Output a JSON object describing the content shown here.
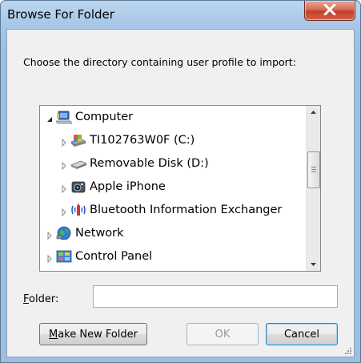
{
  "window": {
    "title": "Browse For Folder"
  },
  "instruction": "Choose the directory containing user profile to import:",
  "tree": {
    "items": [
      {
        "label": "Computer",
        "expanded": true,
        "icon": "computer-icon"
      },
      {
        "label": "TI102763W0F (C:)",
        "expanded": false,
        "icon": "hard-drive-icon"
      },
      {
        "label": "Removable Disk (D:)",
        "expanded": false,
        "icon": "removable-disk-icon"
      },
      {
        "label": "Apple iPhone",
        "expanded": false,
        "icon": "camera-device-icon"
      },
      {
        "label": "Bluetooth Information Exchanger",
        "expanded": false,
        "icon": "bluetooth-icon"
      },
      {
        "label": "Network",
        "expanded": false,
        "icon": "network-icon"
      },
      {
        "label": "Control Panel",
        "expanded": false,
        "icon": "control-panel-icon"
      }
    ]
  },
  "folder": {
    "label_accel": "F",
    "label_rest": "older:",
    "value": ""
  },
  "buttons": {
    "make_new_accel": "M",
    "make_new_rest": "ake New Folder",
    "ok": "OK",
    "cancel": "Cancel"
  },
  "colors": {
    "close_red": "#c2402a",
    "title_blue": "#a9c8e8",
    "border": "#828790"
  }
}
